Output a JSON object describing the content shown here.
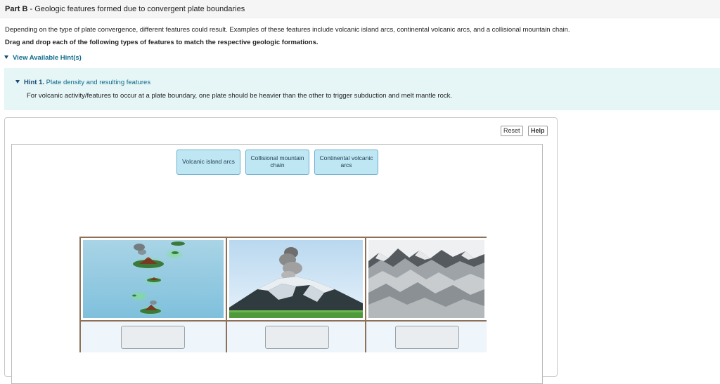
{
  "header": {
    "part": "Part B",
    "sep": " - ",
    "title": "Geologic features formed due to convergent plate boundaries"
  },
  "intro": "Depending on the type of plate convergence, different features could result. Examples of these features include volcanic island arcs, continental volcanic arcs, and a collisional mountain chain.",
  "instruction": "Drag and drop each of the following types of features to match the respective geologic formations.",
  "hints": {
    "view_label": "View Available Hint(s)",
    "items": [
      {
        "number": "Hint 1.",
        "title": " Plate density and resulting features",
        "body": "For volcanic activity/features to occur at a plate boundary, one plate should be heavier than the other to trigger subduction and melt mantle rock."
      }
    ]
  },
  "toolbar": {
    "reset_label": "Reset",
    "help_label": "Help"
  },
  "labels": [
    "Volcanic island arcs",
    "Collisional mountain chain",
    "Continental volcanic arcs"
  ],
  "images": [
    {
      "icon": "volcanic-island-arc-image"
    },
    {
      "icon": "continental-volcano-image"
    },
    {
      "icon": "mountain-range-image"
    }
  ],
  "colors": {
    "tile_bg": "#bfe7f3",
    "tile_border": "#6aaecf",
    "hint_bg": "#e6f5f6",
    "link": "#0f6b8f",
    "grid_border": "#8e6f58"
  }
}
